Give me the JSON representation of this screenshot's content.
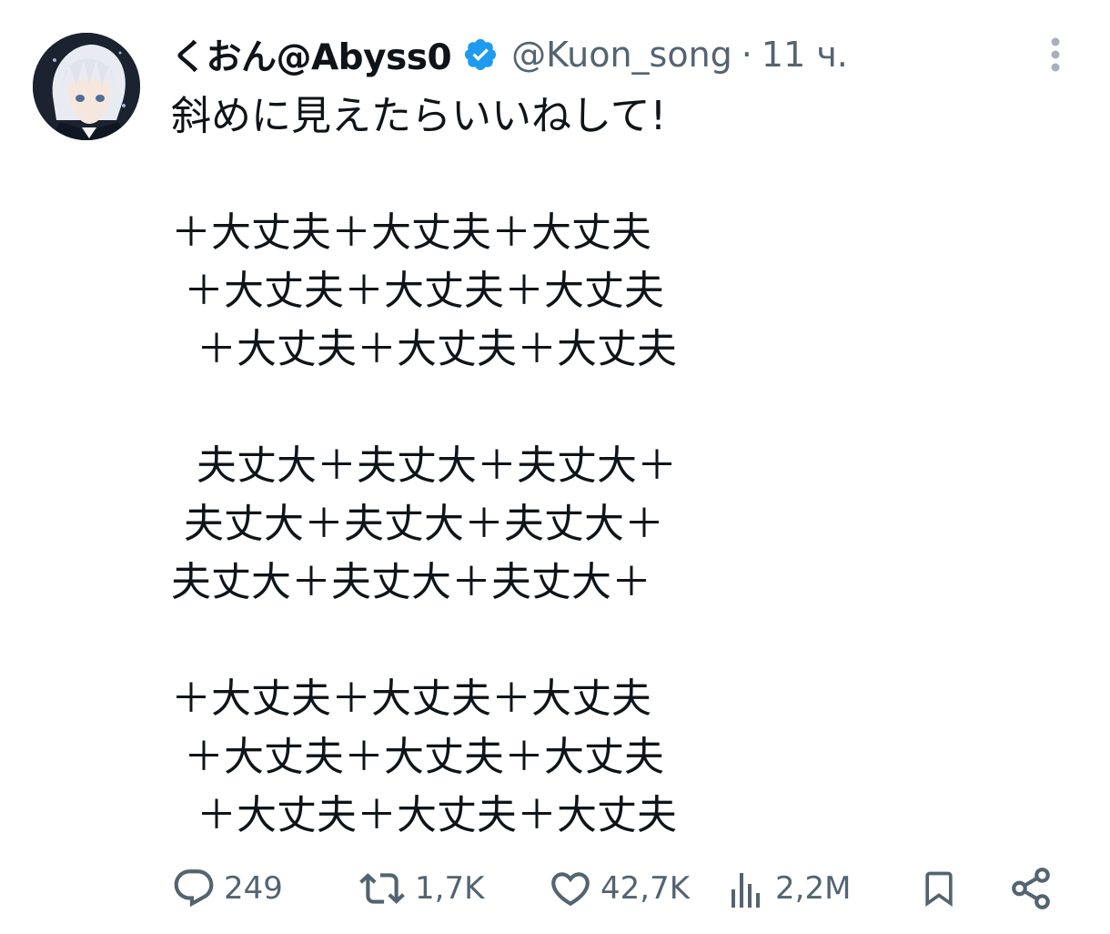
{
  "tweet": {
    "author": {
      "display_name": "くおん@Abyss0",
      "handle": "@Kuon_song",
      "verified": true
    },
    "separator": "·",
    "time": "11 ч.",
    "lines": [
      "斜めに見えたらいいねして!",
      "",
      "＋大丈夫＋大丈夫＋大丈夫",
      " ＋大丈夫＋大丈夫＋大丈夫",
      "  ＋大丈夫＋大丈夫＋大丈夫",
      "",
      "  夫丈大＋夫丈大＋夫丈大＋",
      " 夫丈大＋夫丈大＋夫丈大＋",
      "夫丈大＋夫丈大＋夫丈大＋",
      "",
      "＋大丈夫＋大丈夫＋大丈夫",
      " ＋大丈夫＋大丈夫＋大丈夫",
      "  ＋大丈夫＋大丈夫＋大丈夫"
    ],
    "stats": {
      "replies": "249",
      "retweets": "1,7K",
      "likes": "42,7K",
      "views": "2,2M"
    }
  },
  "icons": {
    "verified": "verified-badge-icon",
    "more": "more-vertical-icon",
    "reply": "reply-icon",
    "retweet": "retweet-icon",
    "like": "heart-icon",
    "views": "views-chart-icon",
    "bookmark": "bookmark-icon",
    "share": "share-icon"
  },
  "colors": {
    "text_primary": "#0f1419",
    "text_secondary": "#536471",
    "verified_blue": "#1d9bf0"
  }
}
